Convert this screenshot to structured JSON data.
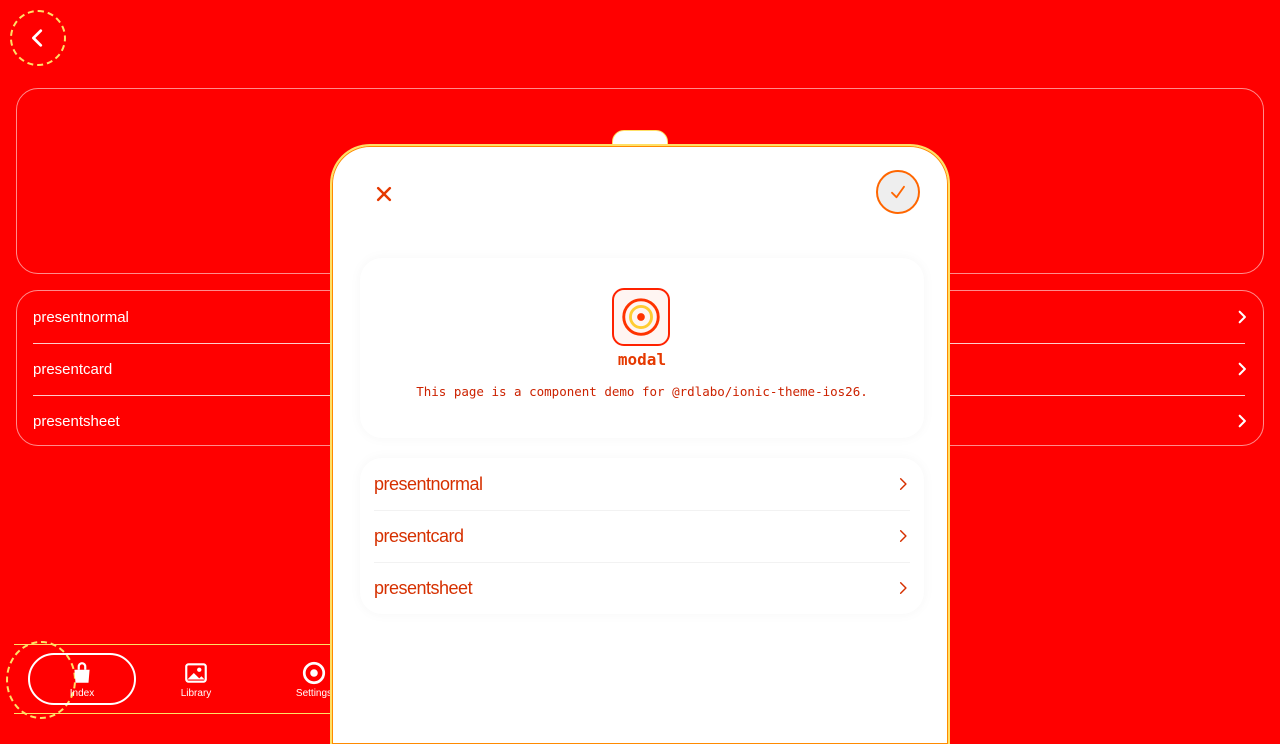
{
  "colors": {
    "background": "#ff0000",
    "accent": "#e53900",
    "highlight": "#ffe066",
    "modal_bg": "#ffffff"
  },
  "background_page": {
    "back_icon": "chevron-left-icon",
    "list": [
      {
        "label": "presentnormal",
        "icon": "chevron-right-icon"
      },
      {
        "label": "presentcard",
        "icon": "chevron-right-icon"
      },
      {
        "label": "presentsheet",
        "icon": "chevron-right-icon"
      }
    ]
  },
  "tabbar": {
    "tabs": [
      {
        "label": "Index",
        "icon": "bag-icon",
        "active": true
      },
      {
        "label": "Library",
        "icon": "image-icon",
        "active": false
      },
      {
        "label": "Settings",
        "icon": "settings-icon",
        "active": false
      }
    ]
  },
  "modal": {
    "close_icon": "close-icon",
    "confirm_icon": "checkmark-icon",
    "intro": {
      "logo_icon": "app-logo-icon",
      "title": "modal",
      "description": "This page is a component demo for @rdlabo/ionic-theme-ios26."
    },
    "list": [
      {
        "label": "presentnormal",
        "icon": "chevron-right-icon"
      },
      {
        "label": "presentcard",
        "icon": "chevron-right-icon"
      },
      {
        "label": "presentsheet",
        "icon": "chevron-right-icon"
      }
    ]
  }
}
